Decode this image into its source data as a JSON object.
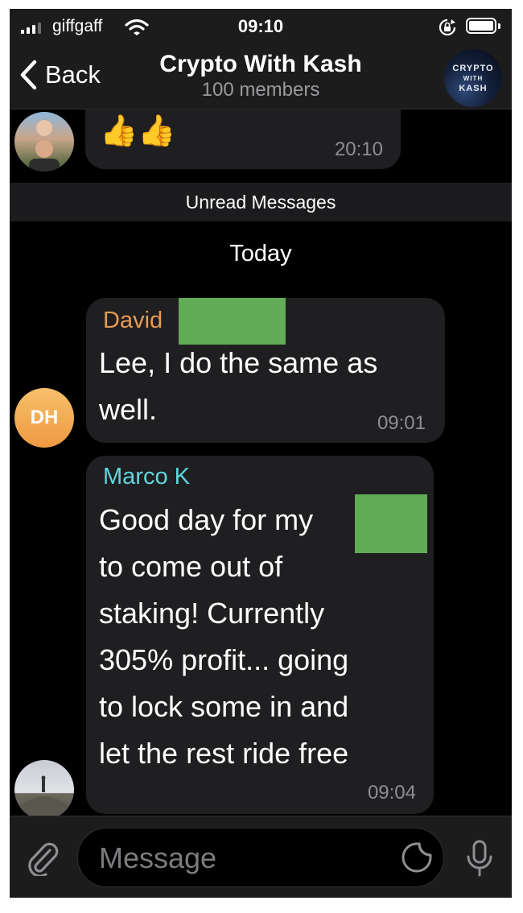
{
  "status_bar": {
    "carrier": "giffgaff",
    "time": "09:10",
    "signal_bars": 4,
    "signal_bars_active": 3,
    "icons": [
      "signal-icon",
      "wifi-icon",
      "rotation-lock-icon",
      "battery-icon"
    ]
  },
  "nav": {
    "back_label": "Back",
    "title": "Crypto With Kash",
    "subtitle": "100 members",
    "avatar_lines": [
      "CRYPTO",
      "WITH",
      "KASH"
    ]
  },
  "previous_message": {
    "emoji": "👍👍",
    "time": "20:10"
  },
  "unread_label": "Unread Messages",
  "date_separator": "Today",
  "messages": [
    {
      "sender": "David",
      "sender_color": "#e69a55",
      "avatar_initials": "DH",
      "text_lines": [
        "Lee, I do the same as",
        "well."
      ],
      "time": "09:01"
    },
    {
      "sender": "Marco K",
      "sender_color": "#5fd5dc",
      "text_lines": [
        "Good day for my",
        "to come out of",
        "staking! Currently",
        "305% profit... going",
        "to lock some in and",
        "let the rest ride free"
      ],
      "time": "09:04"
    }
  ],
  "input": {
    "placeholder": "Message"
  },
  "colors": {
    "background": "#000000",
    "bubble": "#1f1f21",
    "bar": "#1c1c1d",
    "timestamp": "#8e8e93",
    "redaction": "#62ab57"
  }
}
